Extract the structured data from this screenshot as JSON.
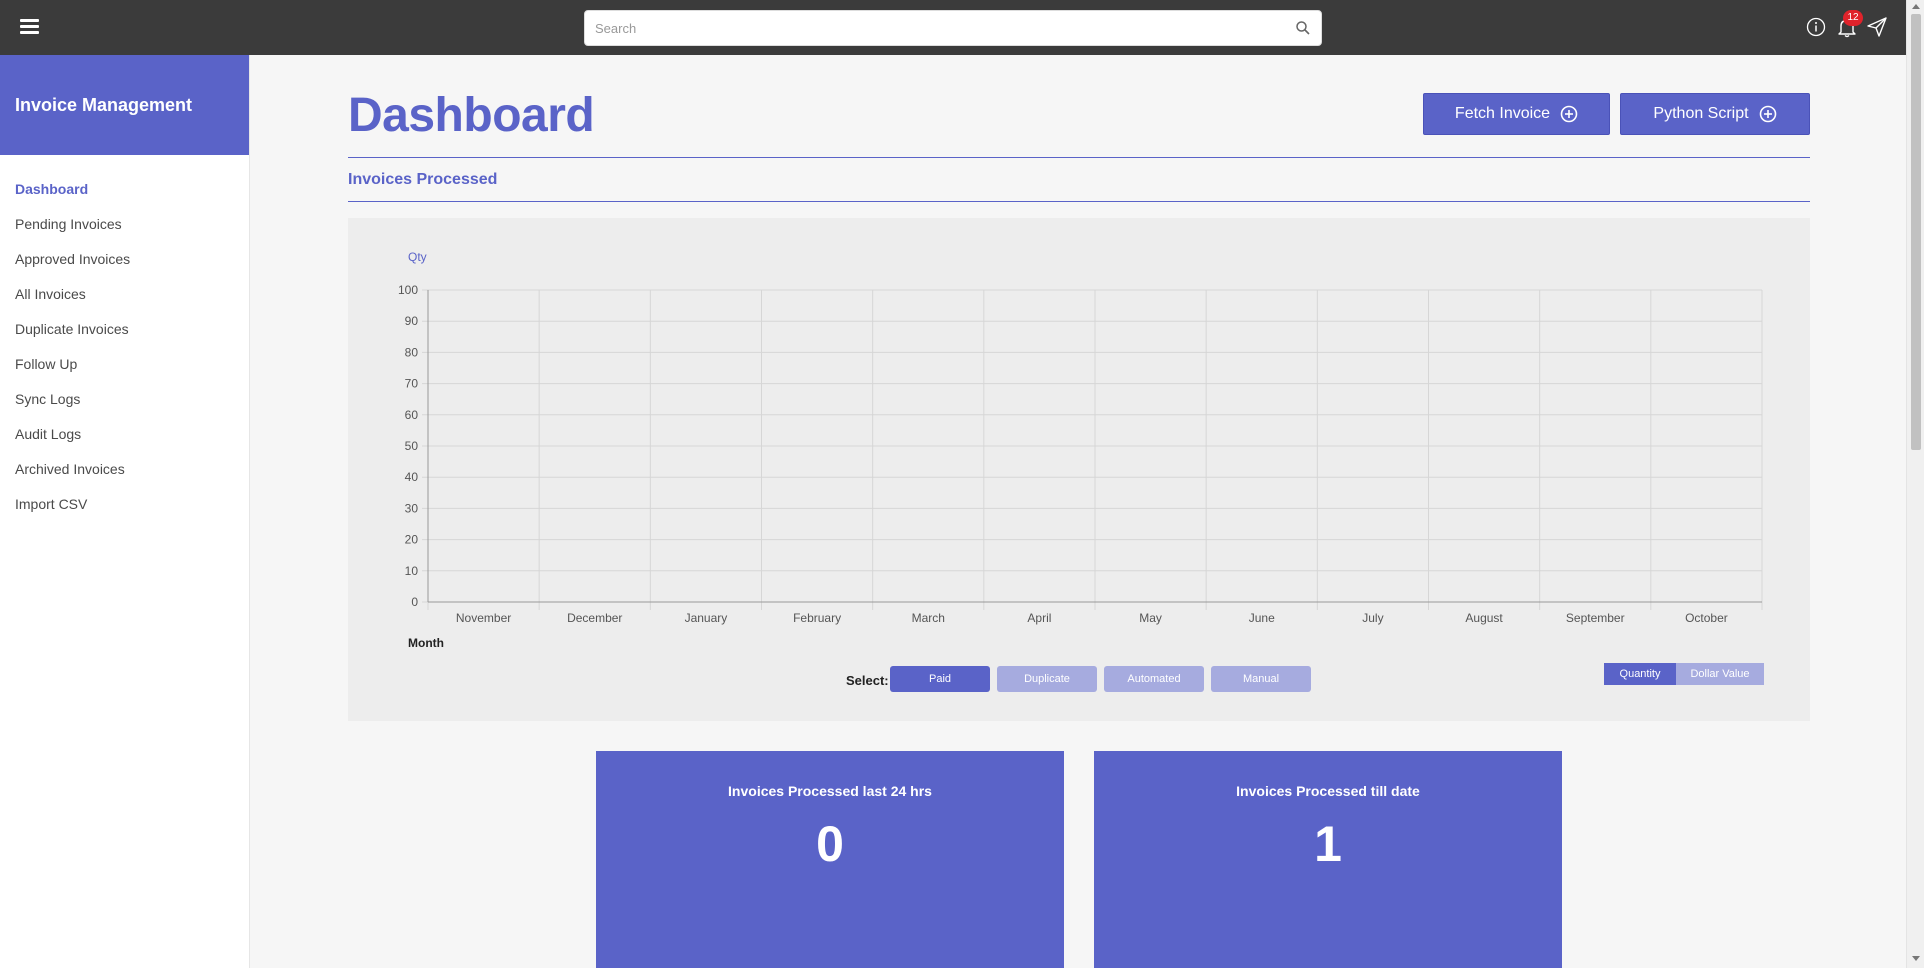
{
  "topbar": {
    "search_placeholder": "Search",
    "notification_count": "12"
  },
  "sidebar": {
    "brand": "Invoice Management",
    "items": [
      {
        "label": "Dashboard",
        "active": true
      },
      {
        "label": "Pending Invoices"
      },
      {
        "label": "Approved Invoices"
      },
      {
        "label": "All Invoices"
      },
      {
        "label": "Duplicate Invoices"
      },
      {
        "label": "Follow Up"
      },
      {
        "label": "Sync Logs"
      },
      {
        "label": "Audit Logs"
      },
      {
        "label": "Archived Invoices"
      },
      {
        "label": "Import CSV"
      }
    ]
  },
  "main": {
    "title": "Dashboard",
    "fetch_button": "Fetch Invoice",
    "python_button": "Python Script",
    "section_title": "Invoices Processed",
    "select_label": "Select:",
    "filters": [
      {
        "label": "Paid",
        "selected": true
      },
      {
        "label": "Duplicate",
        "selected": false
      },
      {
        "label": "Automated",
        "selected": false
      },
      {
        "label": "Manual",
        "selected": false
      }
    ],
    "toggle": {
      "quantity": "Quantity",
      "dollar": "Dollar Value",
      "selected": "Quantity"
    },
    "stats": [
      {
        "label": "Invoices Processed last 24 hrs",
        "value": "0"
      },
      {
        "label": "Invoices Processed till date",
        "value": "1"
      }
    ]
  },
  "colors": {
    "accent": "#5a63c8",
    "accent_light": "#a6abdf",
    "topbar": "#3b3b3b",
    "badge": "#e0232b"
  },
  "chart_data": {
    "type": "bar",
    "categories": [
      "November",
      "December",
      "January",
      "February",
      "March",
      "April",
      "May",
      "June",
      "July",
      "August",
      "September",
      "October"
    ],
    "values": [
      0,
      0,
      0,
      0,
      0,
      0,
      0,
      0,
      0,
      0,
      0,
      0
    ],
    "ylabel": "Qty",
    "xlabel": "Month",
    "ylim": [
      0,
      100
    ],
    "yticks": [
      0,
      10,
      20,
      30,
      40,
      50,
      60,
      70,
      80,
      90,
      100
    ],
    "grid": true
  }
}
